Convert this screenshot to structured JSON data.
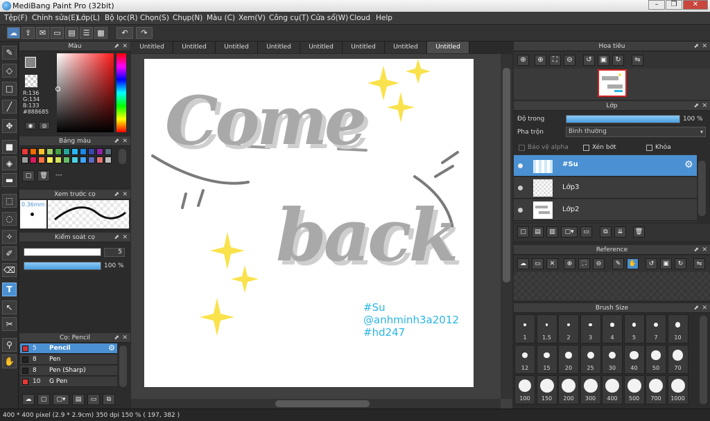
{
  "window": {
    "title": "MediBang Paint Pro (32bit)"
  },
  "menu": [
    "Tệp(F)",
    "Chỉnh sửa(E)",
    "Lớp(L)",
    "Bộ lọc(R)",
    "Chọn(S)",
    "Chụp(N)",
    "Màu (C)",
    "Xem(V)",
    "Công cụ(T)",
    "Cửa sổ(W)",
    "Cloud",
    "Help"
  ],
  "tabs": [
    "Untitled",
    "Untitled",
    "Untitled",
    "Untitled",
    "Untitled",
    "Untitled",
    "Untitled",
    "Untitled"
  ],
  "color_panel": {
    "title": "Màu",
    "r": "R:136",
    "g": "G:134",
    "b": "B:133",
    "hex": "#888685",
    "current_color": "#888685"
  },
  "palette_panel": {
    "title": "Bảng màu",
    "name": "---",
    "swatches": [
      "#e53935",
      "#ef6c00",
      "#fbc02d",
      "#9ccc65",
      "#43a047",
      "#26a69a",
      "#29b6f6",
      "#1e88e5",
      "#3949ab",
      "#8e24aa",
      "#546e7a",
      "#9e9e9e",
      "#d81b60",
      "#ff7043",
      "#ffee58",
      "#d4e157",
      "#66bb6a",
      "#4dd0e1",
      "#42a5f5",
      "#5c6bc0",
      "#e57373",
      "#bdbdbd"
    ]
  },
  "brush_preview": {
    "title": "Xem trước cọ",
    "size": "0.36mm"
  },
  "brush_control": {
    "title": "Kiểm soát cọ",
    "size_value": "5",
    "size_fraction": 0.85,
    "opacity": "100 %",
    "opacity_fraction": 1.0
  },
  "brush_list": {
    "title": "Cọ: Pencil",
    "items": [
      {
        "size": "5",
        "name": "Pencil",
        "color": "#d0343a"
      },
      {
        "size": "8",
        "name": "Pen",
        "color": "#222222"
      },
      {
        "size": "8",
        "name": "Pen (Sharp)",
        "color": "#222222"
      },
      {
        "size": "10",
        "name": "G Pen",
        "color": "#e53935"
      }
    ]
  },
  "canvas": {
    "art_lines": [
      "#Su",
      "@anhminh3a2012",
      "#hd247"
    ],
    "handwriting": [
      "Come",
      "back"
    ]
  },
  "navigator": {
    "title": "Hoa tiêu"
  },
  "layer_panel": {
    "title": "Lớp",
    "opacity_label": "Độ trong",
    "opacity_value": "100 %",
    "opacity_fraction": 1.0,
    "blend_label": "Pha trộn",
    "blend_value": "Bình thường",
    "protect_alpha": "Bảo vệ alpha",
    "clipping": "Xén bớt",
    "lock": "Khóa",
    "layers": [
      {
        "name": "#Su",
        "selected": true
      },
      {
        "name": "Lớp3",
        "selected": false
      },
      {
        "name": "Lớp2",
        "selected": false
      }
    ]
  },
  "reference_panel": {
    "title": "Reference"
  },
  "brush_size_panel": {
    "title": "Brush Size",
    "sizes": [
      "1",
      "1.5",
      "2",
      "3",
      "4",
      "5",
      "7",
      "10",
      "12",
      "15",
      "20",
      "25",
      "30",
      "40",
      "50",
      "70",
      "100",
      "150",
      "200",
      "300",
      "400",
      "500",
      "700",
      "1000"
    ]
  },
  "status": {
    "text": "400 * 400 pixel   (2.9 * 2.9cm)   350 dpi   150 %   ( 197, 382 )"
  },
  "colors": {
    "accent": "#4a90d2",
    "yellow": "#f9e24b",
    "cyan": "#29b6e6",
    "gray": "#9a9a9a"
  }
}
